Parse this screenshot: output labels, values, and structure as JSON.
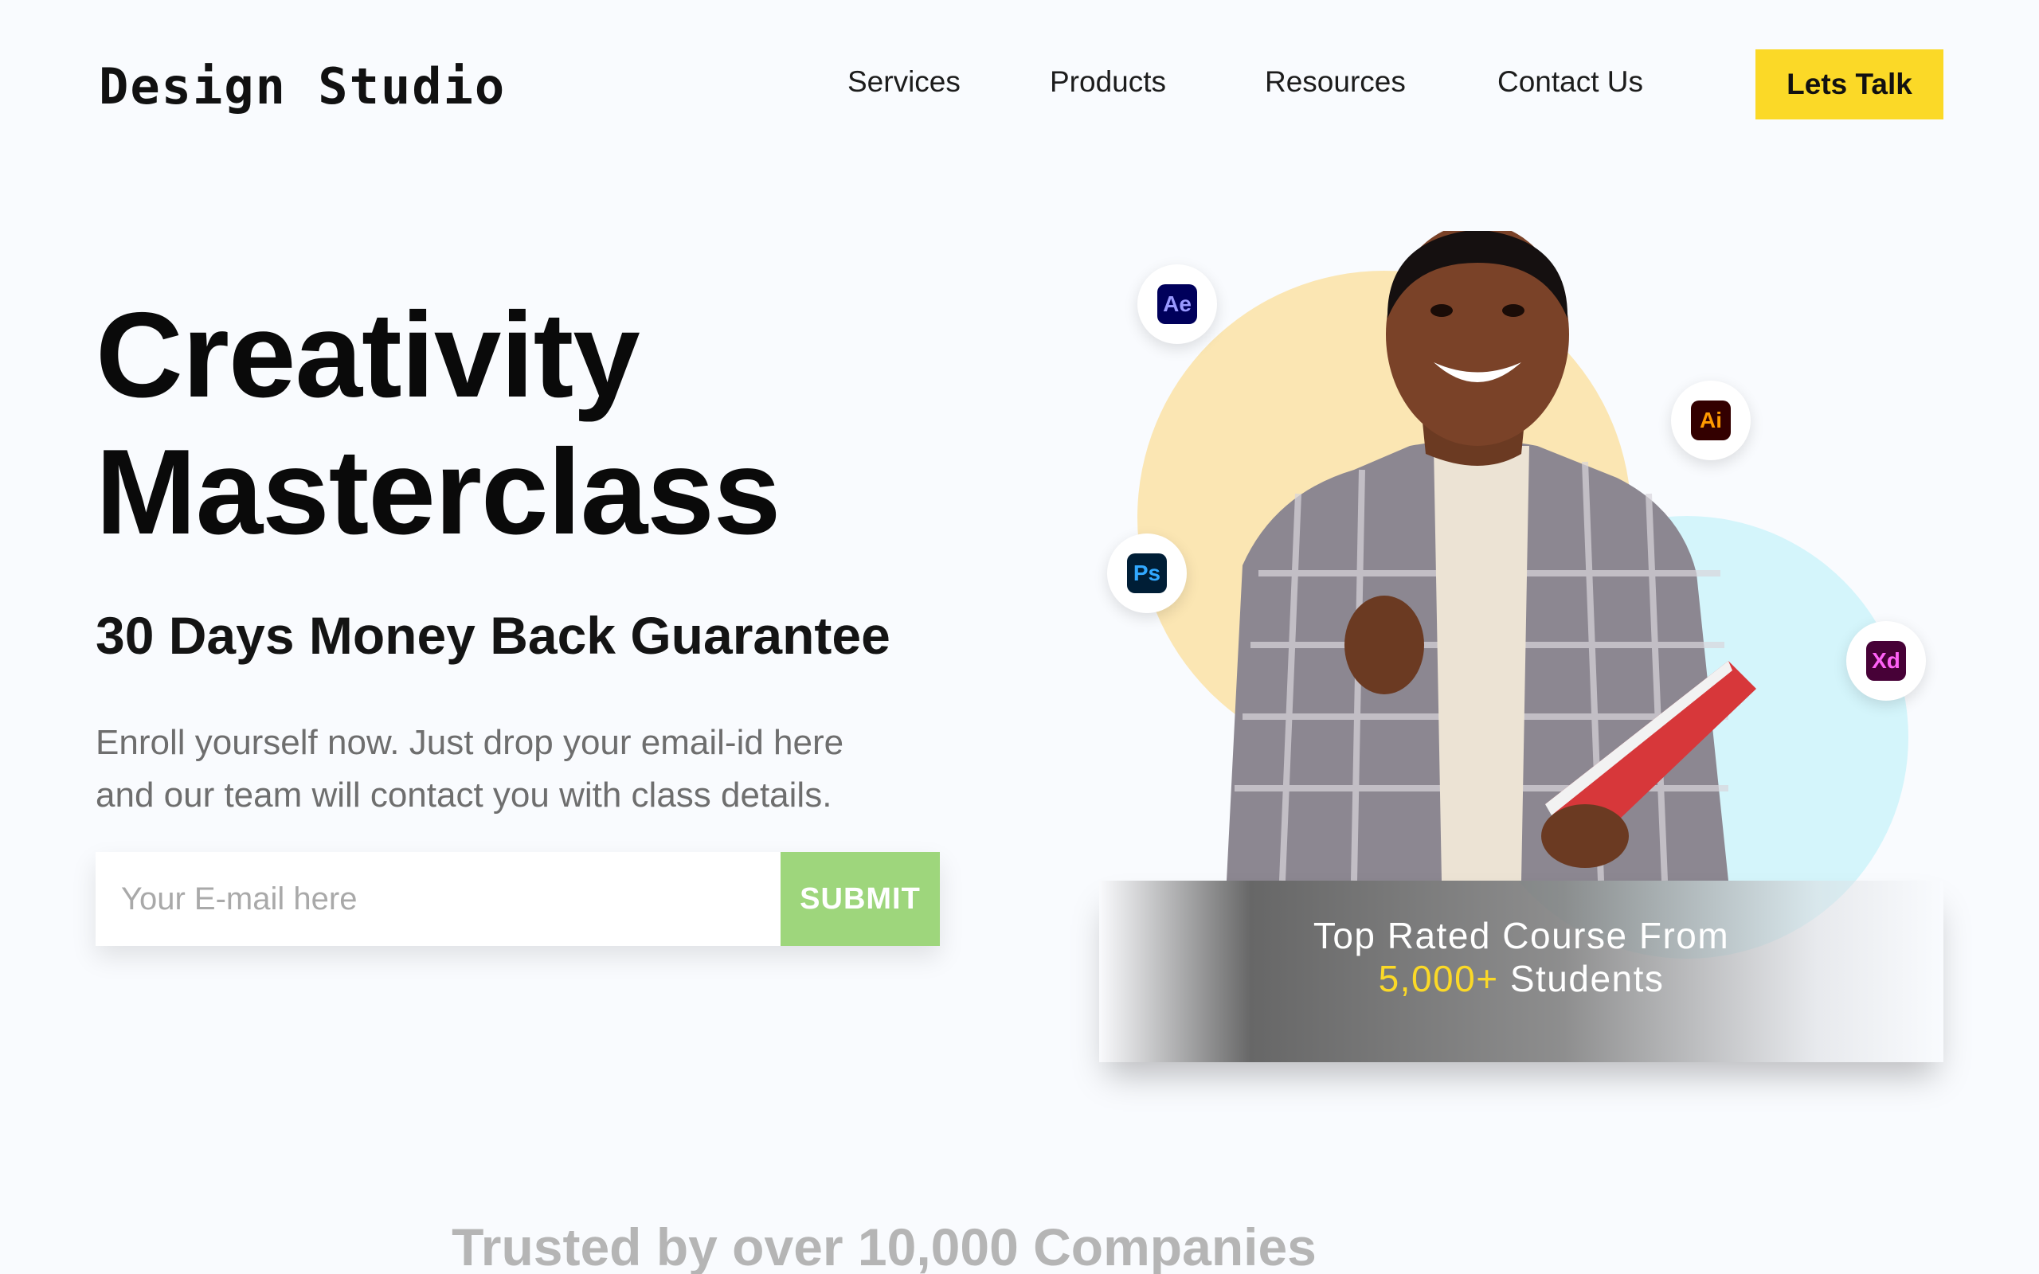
{
  "brand": {
    "logo_text": "Design Studio"
  },
  "nav": {
    "items": [
      {
        "label": "Services"
      },
      {
        "label": "Products"
      },
      {
        "label": "Resources"
      },
      {
        "label": "Contact Us"
      }
    ],
    "cta_label": "Lets Talk"
  },
  "hero": {
    "title_line1": "Creativity",
    "title_line2": "Masterclass",
    "guarantee": "30 Days Money Back Guarantee",
    "description_line1": "Enroll yourself now. Just drop your email-id here",
    "description_line2": "and our team will contact you with class details.",
    "email_placeholder": "Your E-mail here",
    "submit_label": "SUBMIT"
  },
  "app_icons": [
    {
      "label": "Ae",
      "icon": "after-effects-icon",
      "bg": "#00005b",
      "fg": "#9999ff"
    },
    {
      "label": "Ai",
      "icon": "illustrator-icon",
      "bg": "#330000",
      "fg": "#ff9a00"
    },
    {
      "label": "Ps",
      "icon": "photoshop-icon",
      "bg": "#001e36",
      "fg": "#31a8ff"
    },
    {
      "label": "Xd",
      "icon": "xd-icon",
      "bg": "#470137",
      "fg": "#ff61f6"
    }
  ],
  "banner": {
    "line1": "Top Rated Course From",
    "highlight": "5,000+",
    "line2_rest": " Students"
  },
  "trusted": {
    "heading": "Trusted by over 10,000 Companies"
  },
  "colors": {
    "accent_yellow": "#fbd927",
    "submit_green": "#9ed67c",
    "circle_yellow": "#fbe6b3",
    "circle_blue": "#d4f5fb",
    "background": "#f9fbfe"
  }
}
